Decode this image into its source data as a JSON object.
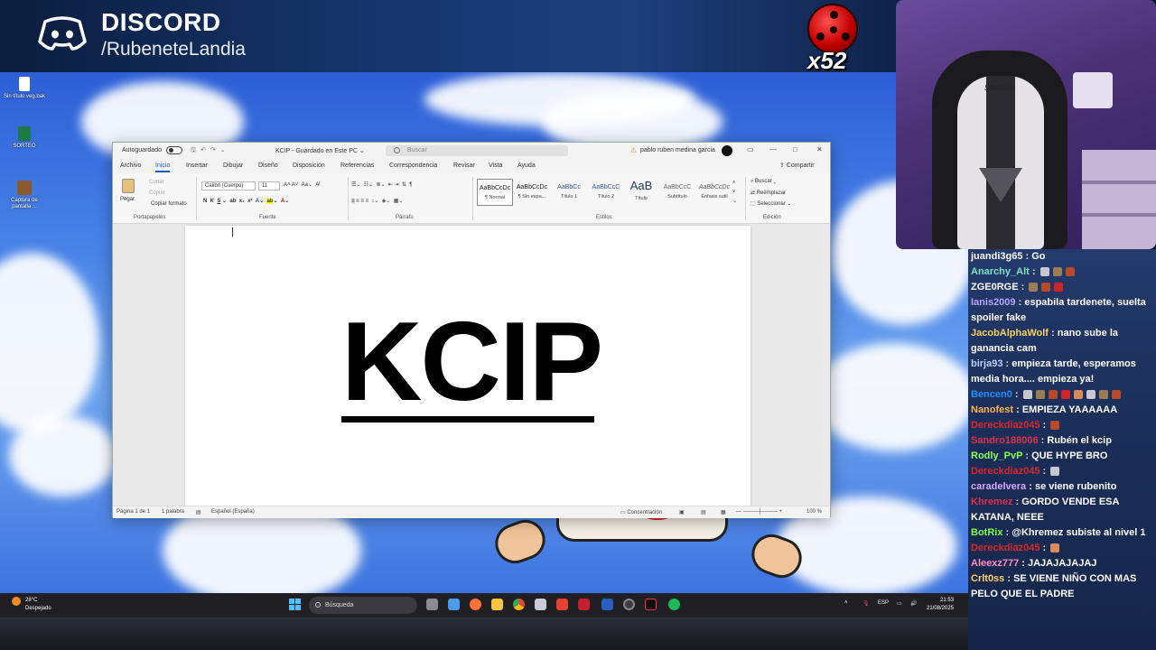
{
  "overlay": {
    "brand": "DISCORD",
    "handle": "/RubeneteLandia",
    "counter": "x52"
  },
  "desktop_icons": [
    {
      "label": "Sin título.veg.bak",
      "icon": "file-icon"
    },
    {
      "label": "SORTEO",
      "icon": "excel-icon"
    },
    {
      "label": "Captura de pantalla ...",
      "icon": "screenshot-file-icon"
    }
  ],
  "word": {
    "autosave_label": "Autoguardado",
    "doc_title": "KCIP  -  Guardado en Este PC  ⌄",
    "search_placeholder": "Buscar",
    "user_name": "pablo ruben medina garcia",
    "menu_tabs": [
      "Archivo",
      "Inicio",
      "Insertar",
      "Dibujar",
      "Diseño",
      "Disposición",
      "Referencias",
      "Correspondencia",
      "Revisar",
      "Vista",
      "Ayuda"
    ],
    "active_tab": "Inicio",
    "share_label": "Compartir",
    "clipboard": {
      "paste": "Pegar",
      "cut": "Cortar",
      "copy": "Copiar",
      "format_painter": "Copiar formato",
      "group": "Portapapeles"
    },
    "font": {
      "family": "Calibri (Cuerpo)",
      "size": "11",
      "group": "Fuente"
    },
    "paragraph_group": "Párrafo",
    "styles": [
      {
        "sample": "AaBbCcDc",
        "name": "¶ Normal"
      },
      {
        "sample": "AaBbCcDc",
        "name": "¶ Sin espa..."
      },
      {
        "sample": "AaBbCc",
        "name": "Título 1"
      },
      {
        "sample": "AaBbCcC",
        "name": "Título 2"
      },
      {
        "sample": "AaB",
        "name": "Título"
      },
      {
        "sample": "AaBbCcC",
        "name": "Subtítulo"
      },
      {
        "sample": "AaBbCcDc",
        "name": "Énfasis sutil"
      }
    ],
    "styles_group": "Estilos",
    "editing": {
      "find": "Buscar",
      "replace": "Reemplazar",
      "select": "Seleccionar",
      "group": "Edición"
    },
    "body_text": "KCIP",
    "status": {
      "page": "Página 1 de 1",
      "words": "1 palabra",
      "language": "Español (España)",
      "focus": "Concentración",
      "zoom": "100 %"
    }
  },
  "taskbar": {
    "temperature": "28°C",
    "weather": "Despejado",
    "search": "Búsqueda",
    "lang": "ESP",
    "time": "21:53",
    "date": "21/08/2025"
  },
  "chat": [
    {
      "user": "juandi3g65",
      "color": "#ffffff",
      "text": "Go"
    },
    {
      "user": "Anarchy_Alt",
      "color": "#7fe3c6",
      "text": "",
      "emotes": 3
    },
    {
      "user": "ZGE0RGE",
      "color": "#ffffff",
      "text": "",
      "emotes": 3
    },
    {
      "user": "Ianis2009",
      "color": "#b9a6ff",
      "text": "espabila tardenete, suelta spoiler fake"
    },
    {
      "user": "JacobAlphaWolf",
      "color": "#f4d35e",
      "text": "nano sube la ganancia cam"
    },
    {
      "user": "birja93",
      "color": "#b9d3ff",
      "text": "empieza tarde, esperamos media hora.... empieza ya!"
    },
    {
      "user": "Bencen0",
      "color": "#1e90ff",
      "text": "",
      "emotes": 8
    },
    {
      "user": "Nanofest",
      "color": "#ffb347",
      "text": "EMPIEZA YAAAAAA"
    },
    {
      "user": "Dereckdiaz045",
      "color": "#d8282b",
      "text": "",
      "emotes": 1
    },
    {
      "user": "Sandro188006",
      "color": "#e0304a",
      "text": "Rubén el kcip"
    },
    {
      "user": "Rodly_PvP",
      "color": "#8dff5a",
      "text": "QUE HYPE BRO"
    },
    {
      "user": "Dereckdiaz045",
      "color": "#d8282b",
      "text": "",
      "emotes": 1
    },
    {
      "user": "caradelvera",
      "color": "#d9a6ff",
      "text": "se viene rubenito"
    },
    {
      "user": "Khremez",
      "color": "#e0304a",
      "text": "GORDO VENDE ESA KATANA, NEEE"
    },
    {
      "user": "BotRix",
      "color": "#7cff4f",
      "text": "@Khremez subiste al nivel 1"
    },
    {
      "user": "Dereckdiaz045",
      "color": "#d8282b",
      "text": "",
      "emotes": 1
    },
    {
      "user": "Aleexz777",
      "color": "#ff8cc6",
      "text": "JAJAJAJAJAJ"
    },
    {
      "user": "Crlt0ss",
      "color": "#ffcf66",
      "text": "SE VIENE NIÑO CON MAS PELO QUE EL PADRE"
    }
  ]
}
